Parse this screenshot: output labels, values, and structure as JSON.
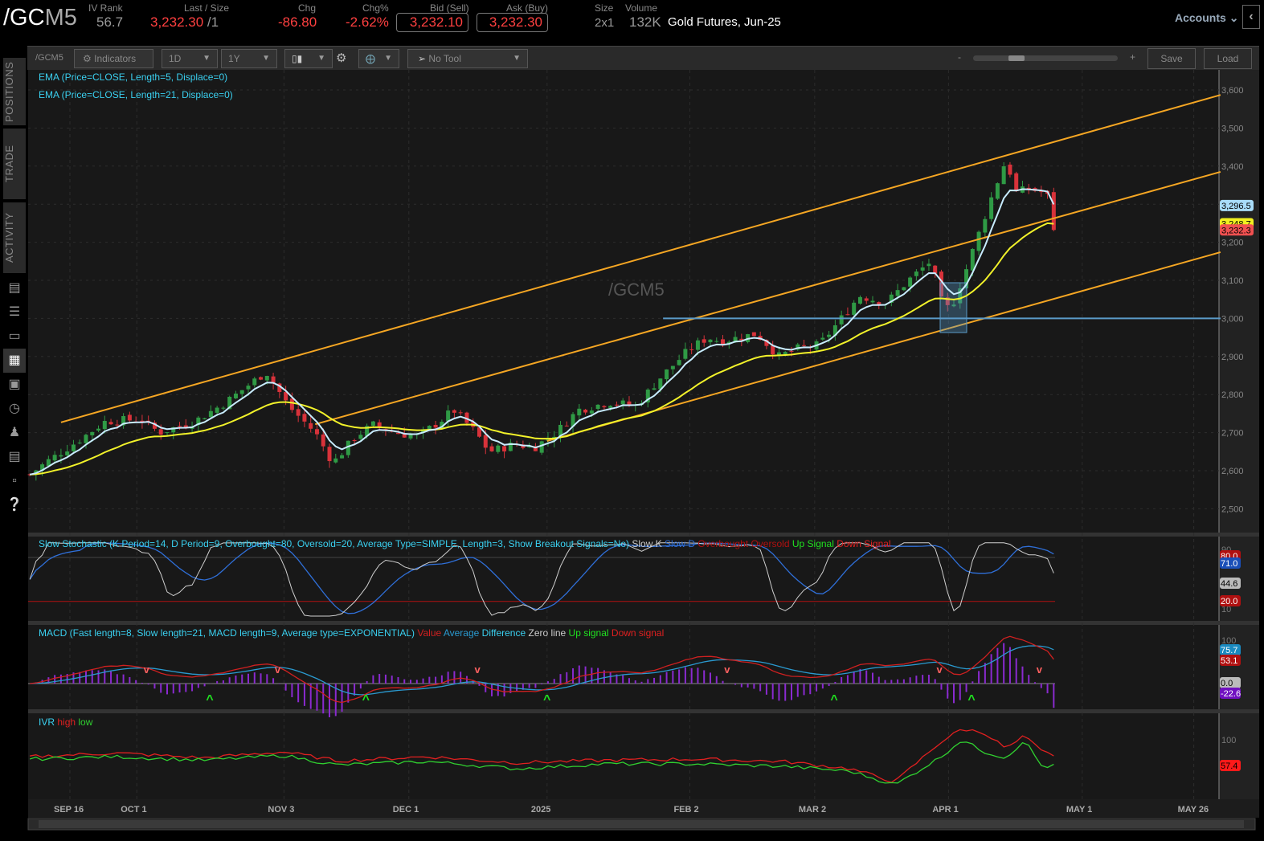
{
  "header": {
    "symbol_prefix": "/GC",
    "symbol_suffix": "M5",
    "iv_rank_label": "IV Rank",
    "iv_rank": "56.7",
    "last_label": "Last / Size",
    "last": "3,232.30",
    "last_size": "/1",
    "chg_label": "Chg",
    "chg": "-86.80",
    "chgpct_label": "Chg%",
    "chgpct": "-2.62%",
    "bid_label": "Bid (Sell)",
    "bid": "3,232.10",
    "ask_label": "Ask (Buy)",
    "ask": "3,232.30",
    "size_label": "Size",
    "size": "2x1",
    "volume_label": "Volume",
    "volume": "132K",
    "description": "Gold Futures, Jun-25",
    "accounts": "Accounts"
  },
  "toolbar": {
    "symbol": "/GCM5",
    "indicators": "Indicators",
    "aggregation": "1D",
    "timeframe": "1Y",
    "tool": "No Tool",
    "zoom_minus": "-",
    "zoom_plus": "+",
    "save": "Save",
    "load": "Load"
  },
  "sidebar": {
    "tabs": [
      "POSITIONS",
      "TRADE",
      "ACTIVITY"
    ]
  },
  "studies": {
    "ema5": "EMA (Price=CLOSE, Length=5, Displace=0)",
    "ema21": "EMA (Price=CLOSE, Length=21, Displace=0)",
    "watermark": "/GCM5",
    "stoch": {
      "title": "Slow Stochastic (K Period=14, D Period=9, Overbought=80, Oversold=20, Average Type=SIMPLE, Length=3, Show Breakout Signals=No)",
      "items": [
        "Slow K",
        "Slow D",
        "Overbought",
        "Oversold",
        "Up Signal",
        "Down Signal"
      ]
    },
    "macd": {
      "title": "MACD (Fast length=8, Slow length=21, MACD length=9, Average type=EXPONENTIAL)",
      "items": [
        "Value",
        "Average",
        "Difference",
        "Zero line",
        "Up signal",
        "Down signal"
      ]
    },
    "ivr": {
      "title": "IVR",
      "items": [
        "high",
        "low"
      ]
    }
  },
  "colors": {
    "up": "#2f9a45",
    "down": "#d8323a",
    "ema5": "#c8ecff",
    "ema21": "#f2f22a",
    "channel": "#f5a623",
    "hline": "#5a9ac8",
    "slowk": "#cfcfcf",
    "slowd": "#2f6fd8",
    "macd_value": "#d02020",
    "macd_avg": "#2a9ad0",
    "macd_diff": "#8a2ad0",
    "ivr_high": "#e02020",
    "ivr_low": "#30d030"
  },
  "chart_data": {
    "type": "candlestick",
    "title": "/GCM5 Gold Futures, Jun-25, 1D 1Y",
    "day_origin": "SEP 16",
    "price_keypoints": [
      [
        -9,
        2590
      ],
      [
        -5,
        2625
      ],
      [
        2,
        2680
      ],
      [
        8,
        2730
      ],
      [
        16,
        2735
      ],
      [
        20,
        2700
      ],
      [
        28,
        2730
      ],
      [
        35,
        2780
      ],
      [
        44,
        2860
      ],
      [
        49,
        2770
      ],
      [
        55,
        2700
      ],
      [
        59,
        2620
      ],
      [
        64,
        2690
      ],
      [
        68,
        2720
      ],
      [
        73,
        2700
      ],
      [
        78,
        2690
      ],
      [
        83,
        2730
      ],
      [
        86,
        2760
      ],
      [
        91,
        2700
      ],
      [
        94,
        2650
      ],
      [
        100,
        2670
      ],
      [
        104,
        2660
      ],
      [
        109,
        2700
      ],
      [
        114,
        2760
      ],
      [
        121,
        2780
      ],
      [
        127,
        2770
      ],
      [
        132,
        2840
      ],
      [
        139,
        2920
      ],
      [
        143,
        2950
      ],
      [
        146,
        2940
      ],
      [
        154,
        2960
      ],
      [
        159,
        2900
      ],
      [
        163,
        2920
      ],
      [
        168,
        2930
      ],
      [
        173,
        3000
      ],
      [
        177,
        3060
      ],
      [
        183,
        3040
      ],
      [
        188,
        3100
      ],
      [
        193,
        3150
      ],
      [
        196,
        3020
      ],
      [
        198,
        3040
      ],
      [
        201,
        3130
      ],
      [
        204,
        3230
      ],
      [
        207,
        3330
      ],
      [
        210,
        3420
      ],
      [
        212,
        3330
      ],
      [
        215,
        3340
      ],
      [
        219,
        3330
      ],
      [
        221,
        3232
      ]
    ],
    "x_ticks": [
      {
        "label": "SEP 16",
        "day": 0
      },
      {
        "label": "OCT 1",
        "day": 15
      },
      {
        "label": "NOV 3",
        "day": 48
      },
      {
        "label": "DEC 1",
        "day": 76
      },
      {
        "label": "2025",
        "day": 107
      },
      {
        "label": "FEB 2",
        "day": 139
      },
      {
        "label": "MAR 2",
        "day": 167
      },
      {
        "label": "APR 1",
        "day": 197
      },
      {
        "label": "MAY 1",
        "day": 227
      },
      {
        "label": "MAY 26",
        "day": 252
      }
    ],
    "y_ticks": [
      "3,600",
      "3,500",
      "3,400",
      "3,300",
      "3,200",
      "3,100",
      "3,000",
      "2,900",
      "2,800",
      "2,700",
      "2,600",
      "2,500"
    ],
    "ylim": [
      2470,
      3650
    ],
    "trendlines": [
      {
        "name": "upper-channel",
        "from": [
          -2,
          2727
        ],
        "to": [
          258,
          3587
        ]
      },
      {
        "name": "middle-channel",
        "from": [
          55,
          2722
        ],
        "to": [
          258,
          3385
        ]
      },
      {
        "name": "lower-channel",
        "from": [
          107,
          2678
        ],
        "to": [
          258,
          3174
        ]
      },
      {
        "name": "support-3000",
        "from": [
          133,
          3000
        ],
        "to": [
          258,
          3000
        ]
      }
    ],
    "price_badges": [
      {
        "label": "3,296.5",
        "series": "ema5"
      },
      {
        "label": "3,248.7",
        "series": "ema21"
      },
      {
        "label": "3,232.3",
        "series": "last"
      }
    ],
    "stoch_axis": [
      "90",
      "10"
    ],
    "stoch_badges": [
      "80.0",
      "71.0",
      "44.6",
      "20.0"
    ],
    "macd_axis": [
      "100"
    ],
    "macd_badges": [
      "75.7",
      "53.1",
      "0.0",
      "-22.6"
    ],
    "ivr_axis": [
      "100"
    ],
    "ivr_badge": "57.4",
    "ivr_high_keypoints": [
      [
        -9,
        72
      ],
      [
        10,
        78
      ],
      [
        30,
        70
      ],
      [
        48,
        80
      ],
      [
        60,
        65
      ],
      [
        80,
        72
      ],
      [
        100,
        62
      ],
      [
        120,
        66
      ],
      [
        140,
        68
      ],
      [
        160,
        64
      ],
      [
        175,
        52
      ],
      [
        185,
        30
      ],
      [
        195,
        95
      ],
      [
        200,
        118
      ],
      [
        205,
        112
      ],
      [
        210,
        85
      ],
      [
        214,
        106
      ],
      [
        218,
        80
      ],
      [
        221,
        74
      ]
    ],
    "ivr_low_keypoints": [
      [
        -9,
        68
      ],
      [
        10,
        72
      ],
      [
        30,
        66
      ],
      [
        48,
        74
      ],
      [
        60,
        58
      ],
      [
        80,
        64
      ],
      [
        100,
        52
      ],
      [
        120,
        60
      ],
      [
        140,
        60
      ],
      [
        160,
        56
      ],
      [
        175,
        48
      ],
      [
        185,
        25
      ],
      [
        195,
        70
      ],
      [
        200,
        100
      ],
      [
        205,
        80
      ],
      [
        210,
        70
      ],
      [
        214,
        100
      ],
      [
        218,
        55
      ],
      [
        221,
        57
      ]
    ]
  }
}
